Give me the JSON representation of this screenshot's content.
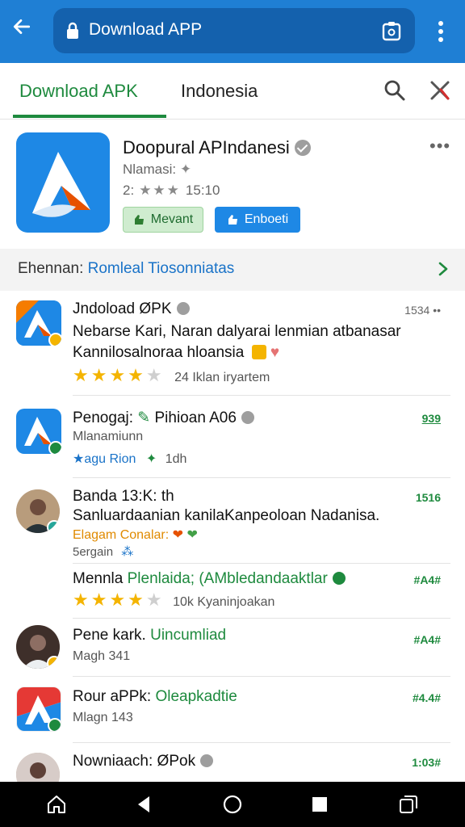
{
  "topbar": {
    "url_text": "Download APP",
    "colors": {
      "bar": "#1f7fd4",
      "url_field": "#1461ad"
    }
  },
  "tabs": {
    "active": "Download APK",
    "second": "Indonesia"
  },
  "featured": {
    "title": "Doopural APIndanesi",
    "subtitle": "Nlamasi:",
    "rating_prefix": "2:",
    "rating_stars": "★★★",
    "rating_suffix": "15:10",
    "btn_primary": "Mevant",
    "btn_secondary": "Enboeti",
    "more": "•••"
  },
  "section": {
    "label": "Ehennan:",
    "link": "Romleal Tiosonniatas"
  },
  "items": [
    {
      "title": "Jndoload ØPK",
      "line1": "Nebarse Kari, Naran dalyarai lenmian atbanasar",
      "line2": "Kannilosalnoraa hloansia",
      "rating_text": "24 Iklan iryartem",
      "stars": 4,
      "meta": "1534 ••",
      "dots": "•••"
    },
    {
      "title": "Penogaj:",
      "title_accent": "Pihioan A06",
      "sub": "Mlanamiunn",
      "sub2_teal": "★agu Rion",
      "sub2_green": "1dh",
      "meta": "939",
      "dots": "•••"
    },
    {
      "title": "Banda 13:K: th",
      "line1": "Sanluardaanian kanilaKanpeoloan Nadanisa.",
      "line2_orange": "Elagam Conalar:",
      "sub": "5ergain",
      "meta": "1516",
      "dots": "••"
    },
    {
      "title": "Mennla",
      "title_accent": "Plenlaida; (AMbledandaaktlar",
      "rating_text": "10k Kyaninjoakan",
      "stars": 4,
      "meta": "#A4#",
      "dots": "••"
    },
    {
      "title": "Pene kark.",
      "title_accent": "Uincumliad",
      "sub": "Magh 341",
      "meta": "#A4#",
      "dots": "••"
    },
    {
      "title": "Rour aPPk:",
      "title_accent": "Oleapkadtie",
      "sub": "Mlagn 143",
      "meta": "#4.4#",
      "dots": "••"
    },
    {
      "title": "Nowniaach: ØPok",
      "meta": "1:03#",
      "dots": "••"
    }
  ]
}
